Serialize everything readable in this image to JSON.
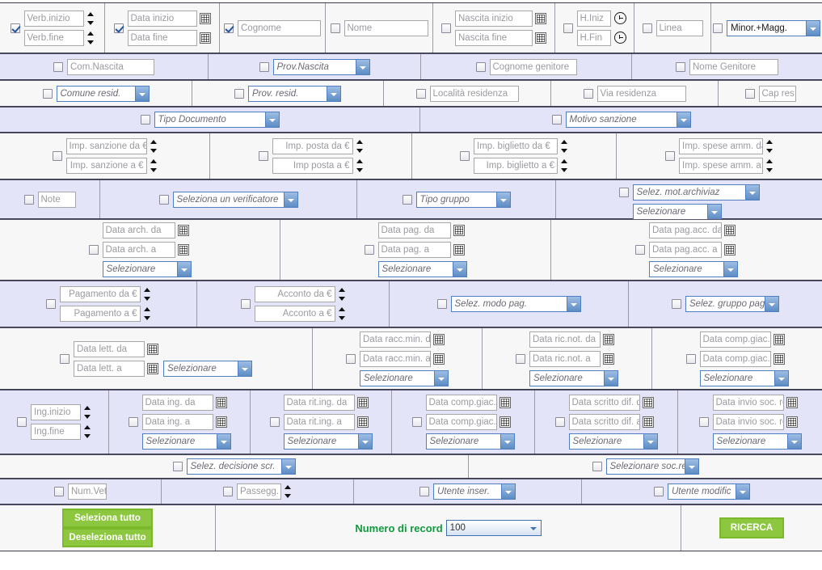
{
  "row1": {
    "verb": {
      "checked": true,
      "start": "Verb.inizio",
      "end": "Verb.fine"
    },
    "data": {
      "checked": true,
      "start": "Data inizio",
      "end": "Data fine"
    },
    "cognome": {
      "checked": true,
      "value": "Cognome"
    },
    "nome": {
      "checked": false,
      "value": "Nome"
    },
    "nascita": {
      "checked": false,
      "start": "Nascita inizio",
      "end": "Nascita fine"
    },
    "ora": {
      "checked": false,
      "start": "H.Iniz",
      "end": "H.Fin"
    },
    "linea": {
      "checked": false,
      "value": "Linea"
    },
    "minormagg": {
      "checked": false,
      "value": "Minor.+Magg."
    }
  },
  "row2": {
    "com_nascita": {
      "checked": false,
      "value": "Com.Nascita"
    },
    "prov_nascita": {
      "checked": false,
      "value": "Prov.Nascita"
    },
    "cognome_genitore": {
      "checked": false,
      "value": "Cognome genitore"
    },
    "nome_genitore": {
      "checked": false,
      "value": "Nome Genitore"
    }
  },
  "row3": {
    "comune_resid": {
      "checked": false,
      "value": "Comune resid."
    },
    "prov_resid": {
      "checked": false,
      "value": "Prov. resid."
    },
    "localita": {
      "checked": false,
      "value": "Località residenza"
    },
    "via": {
      "checked": false,
      "value": "Via residenza"
    },
    "cap": {
      "checked": false,
      "value": "Cap res"
    }
  },
  "row4": {
    "tipo_documento": {
      "checked": false,
      "value": "Tipo Documento"
    },
    "motivo_sanzione": {
      "checked": false,
      "value": "Motivo sanzione"
    }
  },
  "row5": {
    "sanzione": {
      "checked": false,
      "from": "Imp. sanzione da €",
      "to": "Imp. sanzione a €"
    },
    "posta": {
      "checked": false,
      "from": "Imp. posta da €",
      "to": "Imp posta a €"
    },
    "biglietto": {
      "checked": false,
      "from": "Imp. biglietto da €",
      "to": "Imp. biglietto a €"
    },
    "spese": {
      "checked": false,
      "from": "Imp. spese amm. da",
      "to": "Imp. spese amm. a"
    }
  },
  "row6": {
    "note": {
      "checked": false,
      "value": "Note"
    },
    "verificatore": {
      "checked": false,
      "value": "Seleziona un verificatore"
    },
    "tipo_gruppo": {
      "checked": false,
      "value": "Tipo gruppo"
    },
    "mot_archiviaz": {
      "checked": false,
      "value": "Selez. mot.archiviaz",
      "sub": "Selezionare"
    }
  },
  "row7": {
    "arch": {
      "checked": false,
      "from": "Data arch. da",
      "to": "Data arch. a",
      "sel": "Selezionare"
    },
    "pag": {
      "checked": false,
      "from": "Data pag. da",
      "to": "Data pag. a",
      "sel": "Selezionare"
    },
    "pagacc": {
      "checked": false,
      "from": "Data pag.acc. da",
      "to": "Data pag.acc. a",
      "sel": "Selezionare"
    }
  },
  "row8": {
    "pagamento": {
      "checked": false,
      "from": "Pagamento da €",
      "to": "Pagamento a €"
    },
    "acconto": {
      "checked": false,
      "from": "Acconto da €",
      "to": "Acconto a €"
    },
    "modo_pag": {
      "checked": false,
      "value": "Selez. modo pag."
    },
    "gruppo_pag": {
      "checked": false,
      "value": "Selez. gruppo pag."
    }
  },
  "row9": {
    "lett": {
      "checked": false,
      "from": "Data lett. da",
      "to": "Data lett. a",
      "sel": "Selezionare"
    },
    "raccmin": {
      "checked": false,
      "from": "Data racc.min. da",
      "to": "Data racc.min. a",
      "sel": "Selezionare"
    },
    "ricnot": {
      "checked": false,
      "from": "Data ric.not. da",
      "to": "Data ric.not. a",
      "sel": "Selezionare"
    },
    "compgiac": {
      "checked": false,
      "from": "Data comp.giac.",
      "to": "Data comp.giac.",
      "sel": "Selezionare"
    }
  },
  "row10": {
    "ing": {
      "checked": false,
      "start": "Ing.inizio",
      "end": "Ing.fine"
    },
    "data_ing": {
      "checked": false,
      "from": "Data ing. da",
      "to": "Data ing. a",
      "sel": "Selezionare"
    },
    "rit_ing": {
      "checked": false,
      "from": "Data rit.ing. da",
      "to": "Data rit.ing. a",
      "sel": "Selezionare"
    },
    "comp_giac_i": {
      "checked": false,
      "from": "Data comp.giac.i",
      "to": "Data comp.giac.i",
      "sel": "Selezionare"
    },
    "scritto_dif": {
      "checked": false,
      "from": "Data scritto dif. d",
      "to": "Data scritto dif. a",
      "sel": "Selezionare"
    },
    "invio_soc": {
      "checked": false,
      "from": "Data invio soc. re",
      "to": "Data invio soc. re",
      "sel": "Selezionare"
    }
  },
  "row11": {
    "decisione": {
      "checked": false,
      "value": "Selez. decisione scr."
    },
    "soc_rec": {
      "checked": false,
      "value": "Selezionare soc.rec"
    }
  },
  "row12": {
    "num_vet": {
      "checked": false,
      "value": "Num.Vett"
    },
    "passegg": {
      "checked": false,
      "value": "Passegg."
    },
    "utente_inser": {
      "checked": false,
      "value": "Utente inser."
    },
    "utente_modific": {
      "checked": false,
      "value": "Utente modific"
    }
  },
  "footer": {
    "select_all": "Seleziona tutto",
    "deselect_all": "Deseleziona tutto",
    "record_label": "Numero di record",
    "record_value": "100",
    "search_button": "RICERCA"
  },
  "colors": {
    "row_lavender": "#e4e4f8",
    "row_gray": "#f7f7f7",
    "green_button": "#8dc63f",
    "green_text": "#0f9a3e",
    "select_border": "#4f7fc0"
  }
}
